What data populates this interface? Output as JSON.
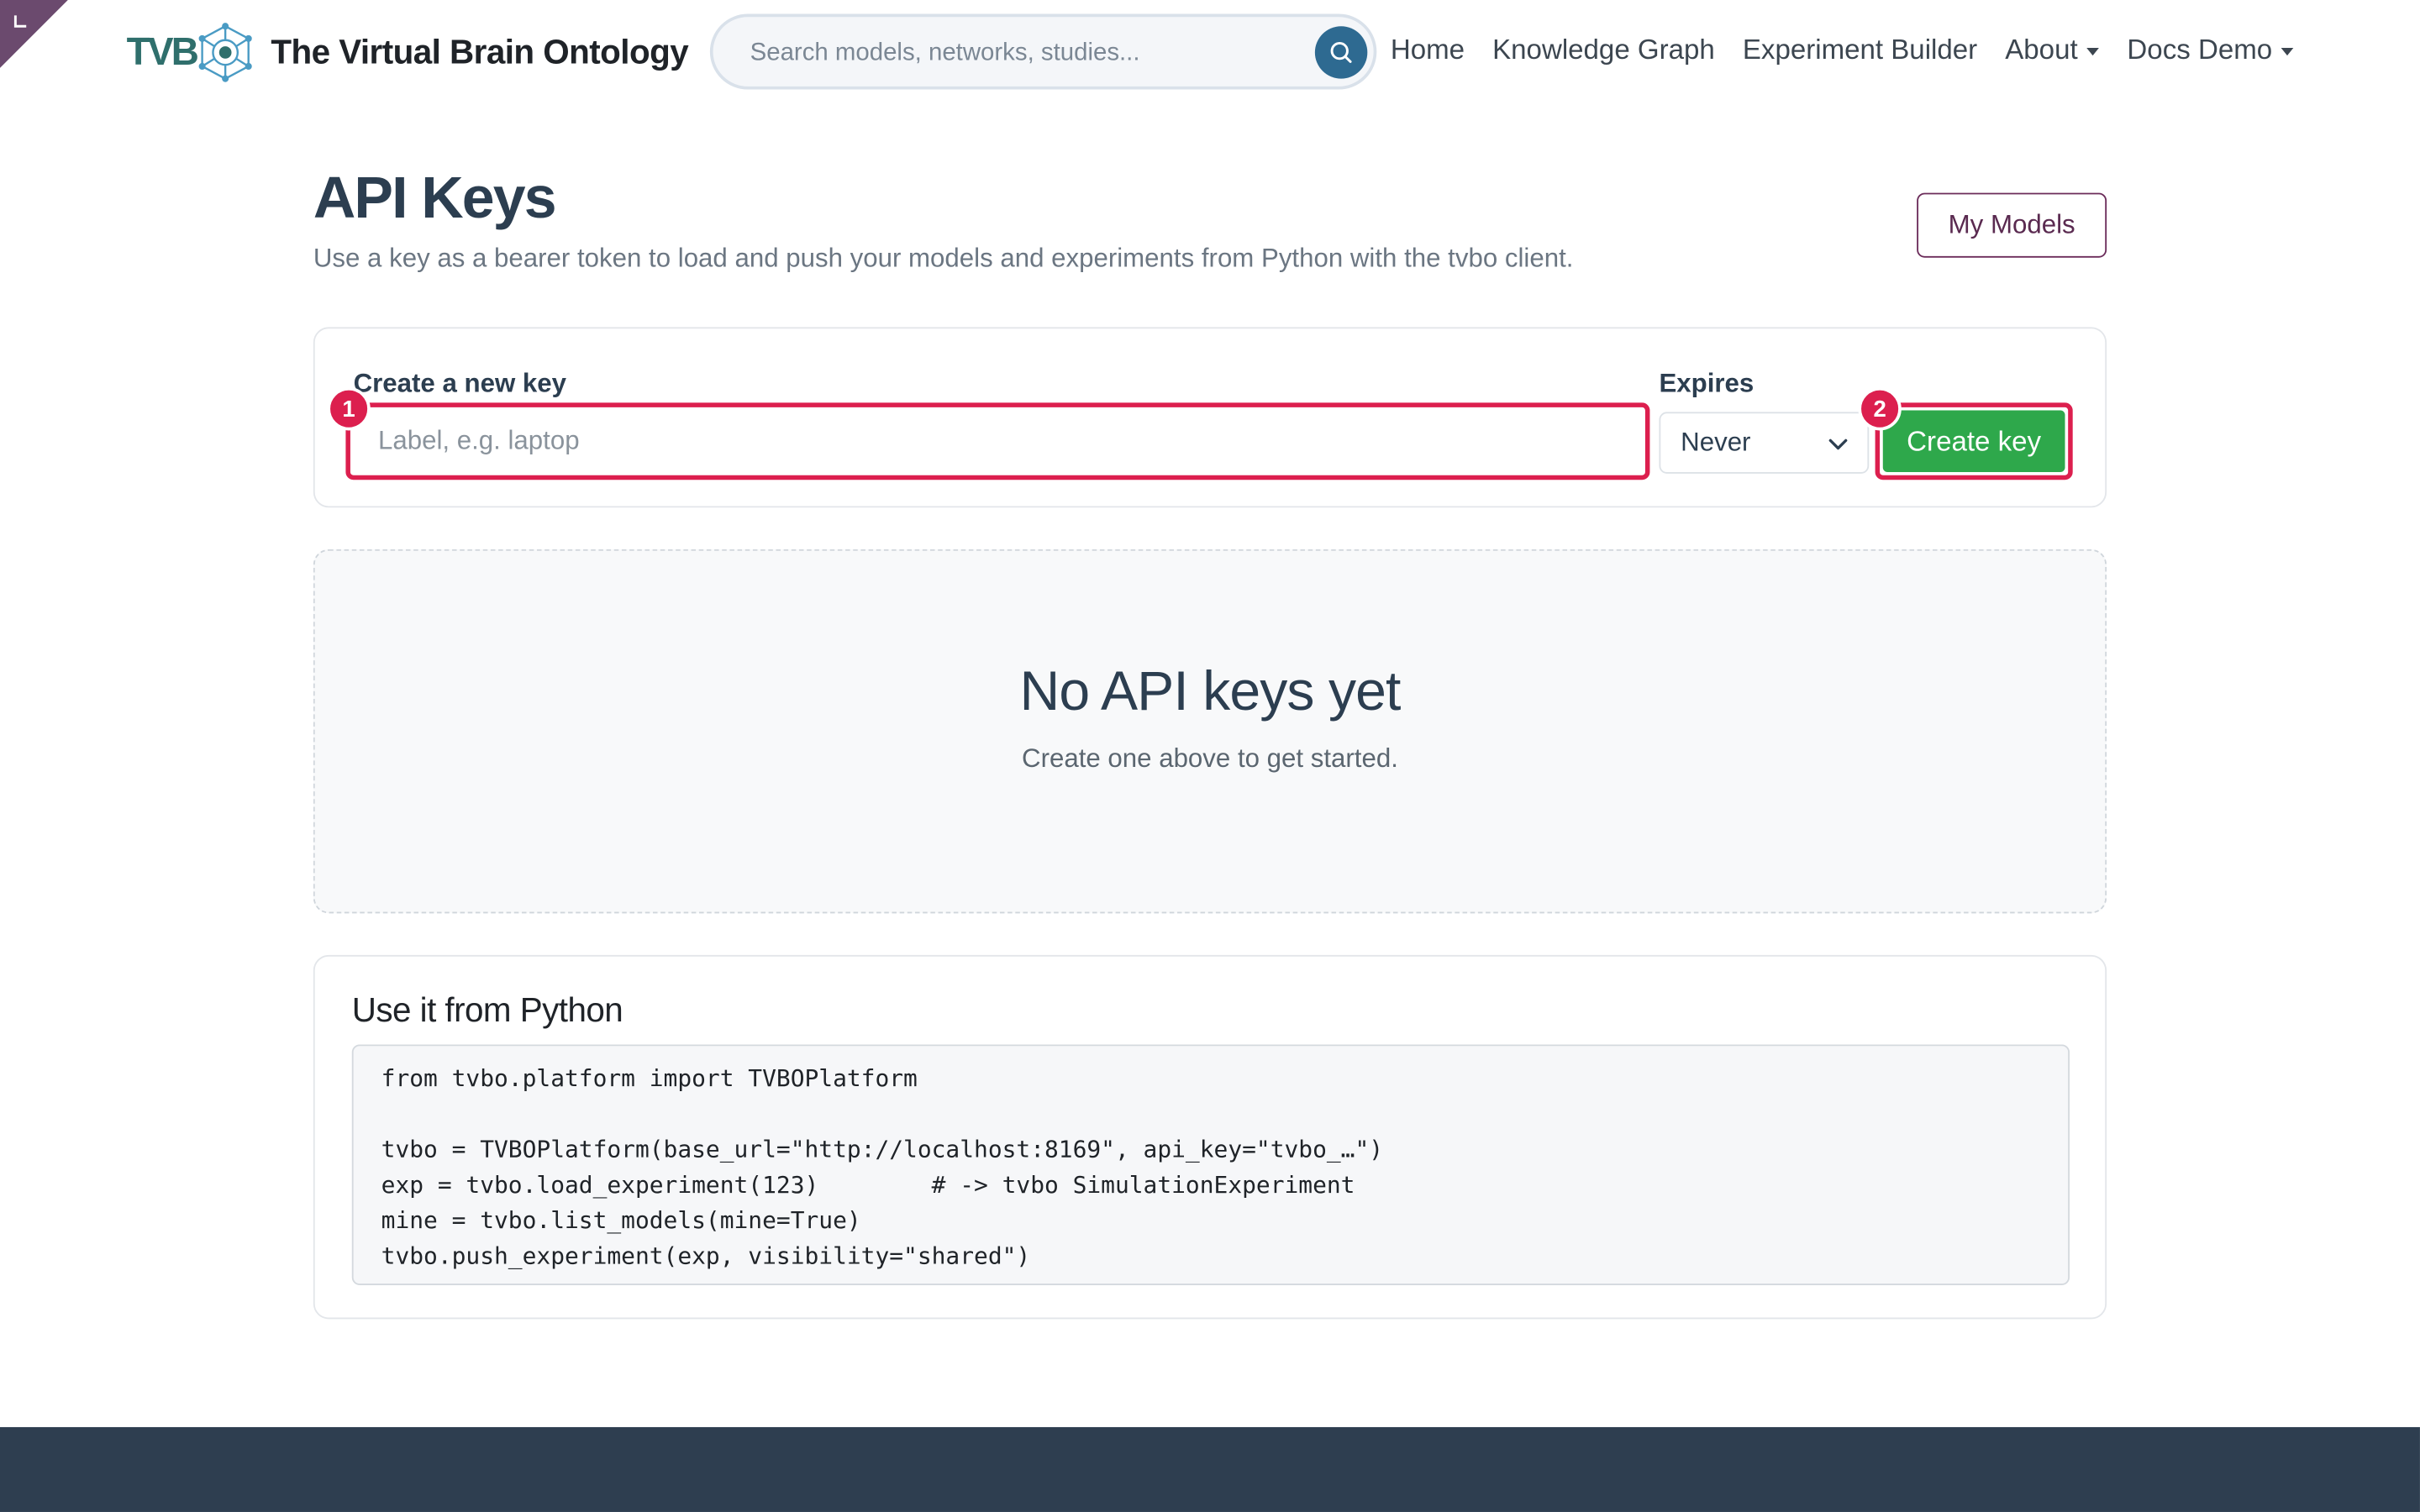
{
  "brand": {
    "logo_text": "TVB",
    "title": "The Virtual Brain Ontology"
  },
  "search": {
    "placeholder": "Search models, networks, studies..."
  },
  "nav": {
    "home": "Home",
    "knowledge_graph": "Knowledge Graph",
    "experiment_builder": "Experiment Builder",
    "about": "About",
    "docs_demo": "Docs Demo"
  },
  "header": {
    "title": "API Keys",
    "subtitle": "Use a key as a bearer token to load and push your models and experiments from Python with the tvbo client.",
    "my_models_label": "My Models"
  },
  "create_key": {
    "label_title": "Create a new key",
    "label_placeholder": "Label, e.g. laptop",
    "expires_title": "Expires",
    "expires_value": "Never",
    "button_label": "Create key",
    "step_1": "1",
    "step_2": "2"
  },
  "empty_state": {
    "title": "No API keys yet",
    "text": "Create one above to get started."
  },
  "python": {
    "title": "Use it from Python",
    "code": "from tvbo.platform import TVBOPlatform\n\ntvbo = TVBOPlatform(base_url=\"http://localhost:8169\", api_key=\"tvbo_…\")\nexp = tvbo.load_experiment(123)        # -> tvbo SimulationExperiment\nmine = tvbo.list_models(mine=True)\ntvbo.push_experiment(exp, visibility=\"shared\")"
  },
  "colors": {
    "accent_red": "#dc1f4e",
    "primary_green": "#2ea84b",
    "brand_teal": "#2f6f6c",
    "footer": "#2e3e50"
  }
}
